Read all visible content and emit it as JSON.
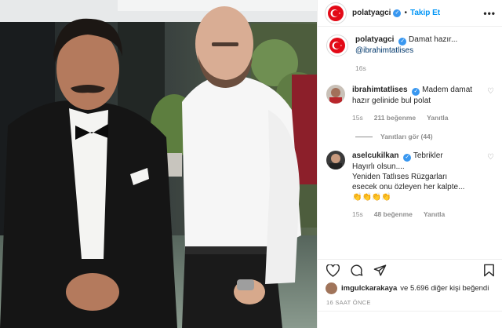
{
  "post": {
    "username": "polatyagci",
    "follow_label": "Takip Et",
    "separator": "•",
    "more_label": "•••",
    "caption_user": "polatyagci",
    "caption_text": "Damat hazır...",
    "caption_mention": "@ibrahimtatlises",
    "caption_time": "16s",
    "likes_user": "imgulckarakaya",
    "likes_rest": "ve 5.696 diğer kişi beğendi",
    "time_ago": "16 SAAT ÖNCE"
  },
  "comments": [
    {
      "user": "ibrahimtatlises",
      "text": "Madem damat hazır gelinide bul polat",
      "time": "15s",
      "likes": "211 beğenme",
      "reply": "Yanıtla",
      "view_replies": "Yanıtları gör (44)"
    },
    {
      "user": "aselcukilkan",
      "text_lines": [
        "Tebrikler",
        "Hayırlı olsun....",
        "Yeniden Tatlıses Rüzgarları",
        "esecek onu özleyen her kalpte...",
        "👏👏👏👏"
      ],
      "time": "15s",
      "likes": "48 beğenme",
      "reply": "Yanıtla"
    }
  ],
  "colors": {
    "accent": "#0095f6",
    "verified": "#3897f0",
    "muted": "#8e8e8e",
    "flag_red": "#e30a17"
  },
  "icons": [
    "heart-icon",
    "comment-icon",
    "share-icon",
    "bookmark-icon",
    "verified-badge-icon",
    "more-options-icon"
  ]
}
